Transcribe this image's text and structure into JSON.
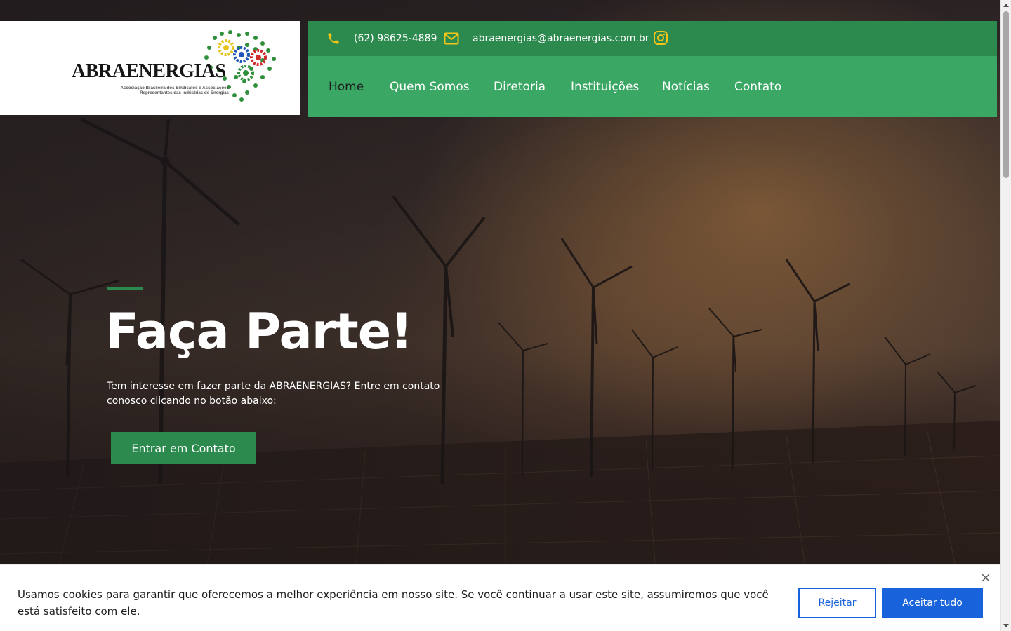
{
  "header": {
    "logo": {
      "wordmark": "ABRAENERGIAS",
      "subtitle_line1": "Associação Brasileira dos Sindicatos e Associações",
      "subtitle_line2": "Representantes das Indústrias de Energias"
    },
    "topbar": {
      "phone": "(62) 98625-4889",
      "email": "abraenergias@abraenergias.com.br",
      "icons": [
        "phone-icon",
        "envelope-icon",
        "instagram-icon"
      ],
      "icon_color": "#f5c518"
    },
    "nav": {
      "items": [
        "Home",
        "Quem Somos",
        "Diretoria",
        "Instituições",
        "Notícias",
        "Contato"
      ],
      "active": "Home"
    }
  },
  "hero": {
    "title": "Faça Parte!",
    "text": "Tem interesse em fazer parte da ABRAENERGIAS? Entre em contato conosco clicando no botão abaixo:",
    "button_label": "Entrar em Contato"
  },
  "cookie_banner": {
    "message": "Usamos cookies para garantir que oferecemos a melhor experiência em nosso site. Se você continuar a usar este site, assumiremos que você está satisfeito com ele.",
    "reject_label": "Rejeitar",
    "accept_label": "Aceitar tudo",
    "close_icon": "close-icon"
  },
  "colors": {
    "topbar_green": "#2d8a4e",
    "nav_green": "#3aa764",
    "accent_green": "#2d8a4e",
    "cookie_blue": "#1863dc"
  }
}
